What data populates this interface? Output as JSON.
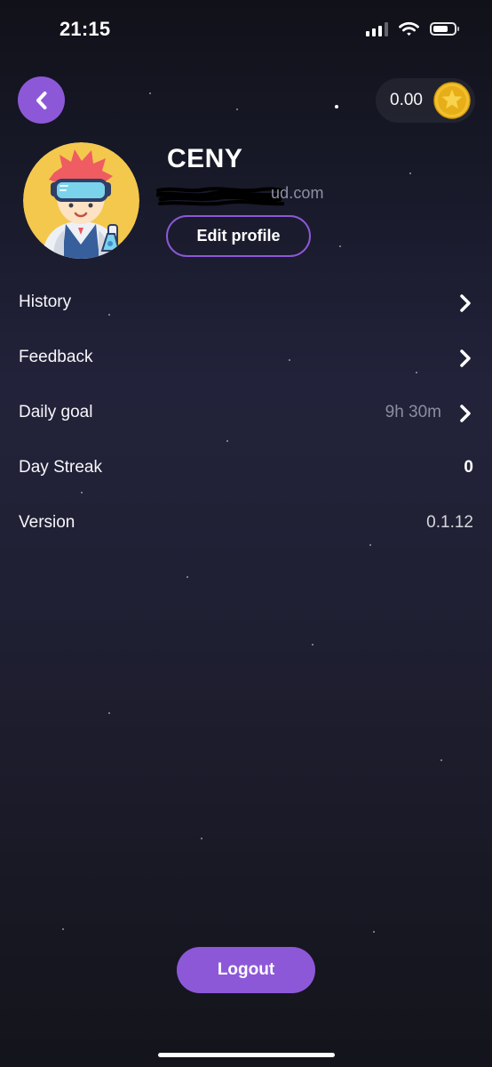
{
  "status_bar": {
    "time": "21:15",
    "signal_icon": "signal-icon",
    "wifi_icon": "wifi-icon",
    "battery_icon": "battery-icon"
  },
  "header": {
    "back_icon": "chevron-left-icon",
    "coin_balance": "0.00",
    "coin_icon": "gold-coin-star-icon"
  },
  "profile": {
    "name": "CENY",
    "email_visible_suffix": "ud.com",
    "edit_button_label": "Edit profile"
  },
  "menu": [
    {
      "label": "History",
      "value": "",
      "chevron": true
    },
    {
      "label": "Feedback",
      "value": "",
      "chevron": true
    },
    {
      "label": "Daily goal",
      "value": "9h 30m",
      "chevron": true
    },
    {
      "label": "Day Streak",
      "value": "0",
      "chevron": false
    },
    {
      "label": "Version",
      "value": "0.1.12",
      "chevron": false
    }
  ],
  "footer": {
    "logout_label": "Logout"
  },
  "colors": {
    "accent": "#8d58d8",
    "background_dark": "#111119",
    "background_mid": "#22223a",
    "muted_text": "#8c8da0",
    "coin_gold": "#f2c02f"
  }
}
